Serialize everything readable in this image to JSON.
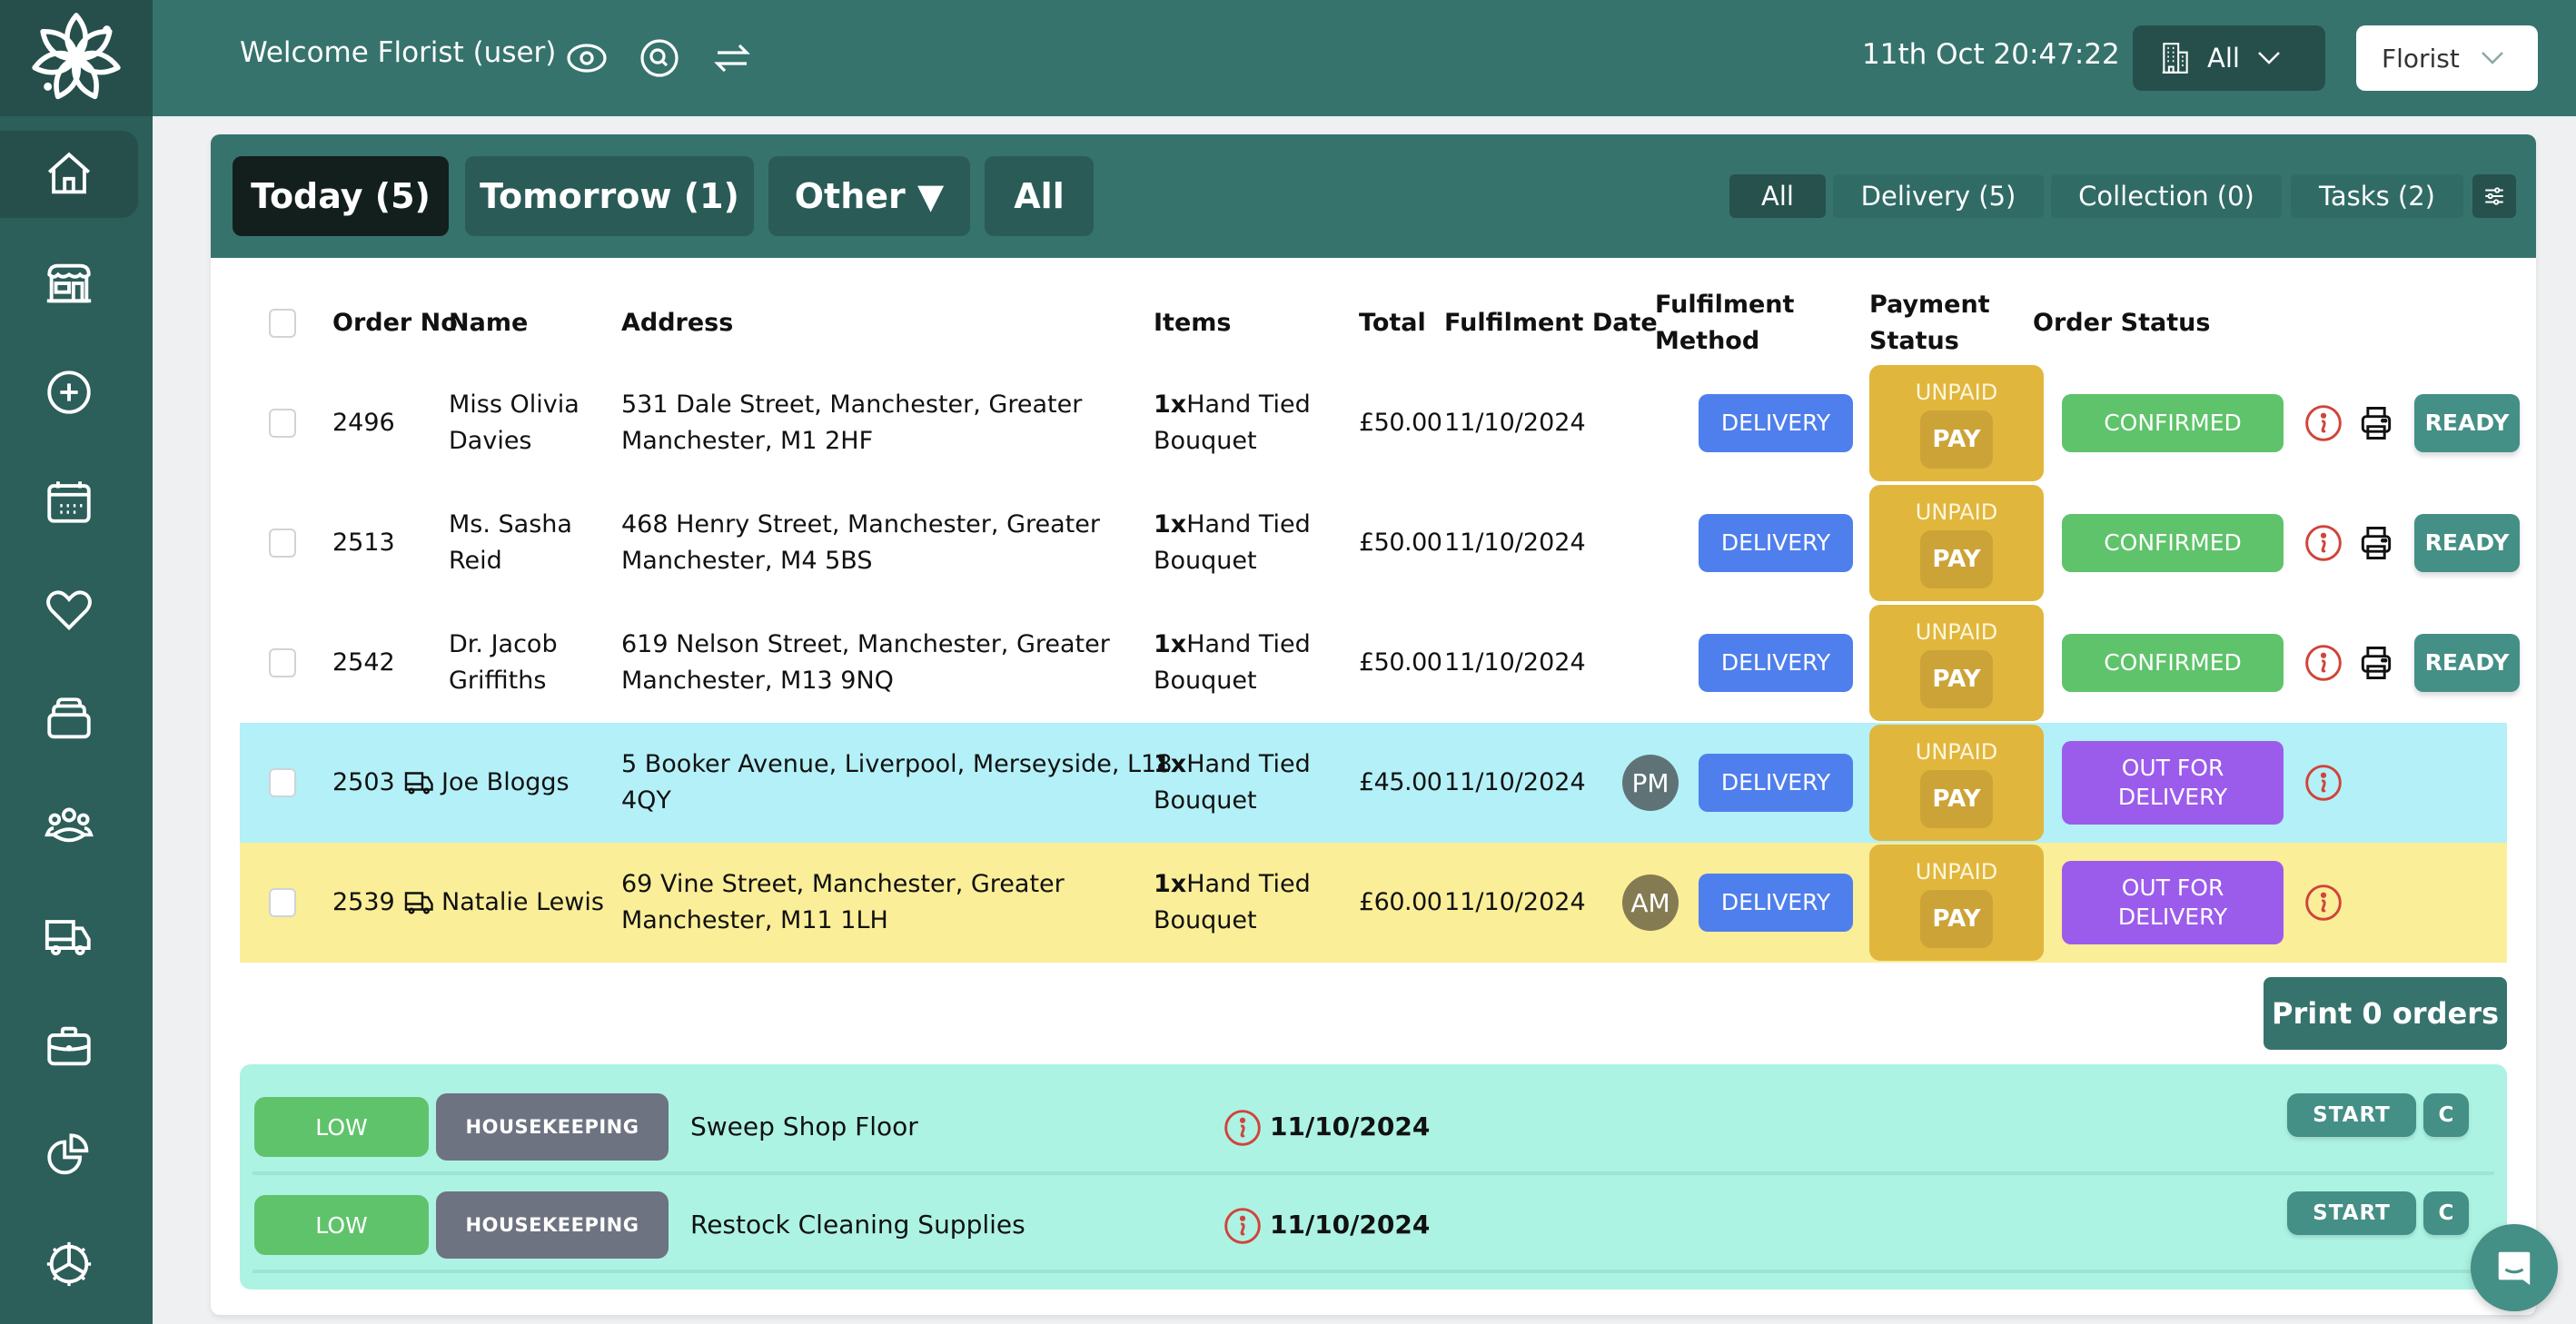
{
  "app": {
    "logo": "flower-logo"
  },
  "header": {
    "welcome": "Welcome Florist (user)",
    "icons": [
      "eye-icon",
      "search-icon",
      "swap-icon"
    ],
    "datetime": "11th Oct 20:47:22",
    "location_select": {
      "icon": "building-icon",
      "value": "All"
    },
    "role_select": {
      "value": "Florist"
    }
  },
  "sidebar": {
    "items": [
      {
        "name": "home",
        "icon": "home-icon",
        "active": true
      },
      {
        "name": "shop",
        "icon": "store-icon"
      },
      {
        "name": "new-order",
        "icon": "plus-circle-icon"
      },
      {
        "name": "calendar",
        "icon": "calendar-icon"
      },
      {
        "name": "favourites",
        "icon": "heart-icon"
      },
      {
        "name": "inventory",
        "icon": "stack-icon"
      },
      {
        "name": "customers",
        "icon": "users-icon"
      },
      {
        "name": "deliveries",
        "icon": "truck-icon"
      },
      {
        "name": "jobs",
        "icon": "briefcase-icon"
      },
      {
        "name": "reports",
        "icon": "pie-chart-icon"
      },
      {
        "name": "settings",
        "icon": "gear-icon"
      }
    ]
  },
  "day_tabs": [
    {
      "label": "Today (5)",
      "active": true
    },
    {
      "label": "Tomorrow (1)"
    },
    {
      "label": "Other ▼"
    },
    {
      "label": "All"
    }
  ],
  "type_tabs": [
    {
      "label": "All",
      "active": true
    },
    {
      "label": "Delivery (5)"
    },
    {
      "label": "Collection (0)"
    },
    {
      "label": "Tasks (2)"
    }
  ],
  "filter_icon": "sliders-icon",
  "table": {
    "headers": {
      "order_no": "Order No",
      "name": "Name",
      "address": "Address",
      "items": "Items",
      "total": "Total",
      "fulfilment_date": "Fulfilment Date",
      "fulfilment_method": [
        "Fulfilment",
        "Method"
      ],
      "payment_status": [
        "Payment",
        "Status"
      ],
      "order_status": "Order Status"
    },
    "rows": [
      {
        "order_no": "2496",
        "name": [
          "Miss Olivia",
          "Davies"
        ],
        "address": [
          "531 Dale Street, Manchester, Greater",
          "Manchester, M1 2HF"
        ],
        "qty": "1x",
        "item": [
          "Hand Tied",
          "Bouquet"
        ],
        "total": "£50.00",
        "date": "11/10/2024",
        "method": "DELIVERY",
        "payment": "UNPAID",
        "pay_label": "PAY",
        "status": [
          "CONFIRMED"
        ],
        "action": "READY",
        "highlight": "none"
      },
      {
        "order_no": "2513",
        "name": [
          "Ms. Sasha",
          "Reid"
        ],
        "address": [
          "468 Henry Street, Manchester, Greater",
          "Manchester, M4 5BS"
        ],
        "qty": "1x",
        "item": [
          "Hand Tied",
          "Bouquet"
        ],
        "total": "£50.00",
        "date": "11/10/2024",
        "method": "DELIVERY",
        "payment": "UNPAID",
        "pay_label": "PAY",
        "status": [
          "CONFIRMED"
        ],
        "action": "READY",
        "highlight": "none"
      },
      {
        "order_no": "2542",
        "name": [
          "Dr. Jacob",
          "Griffiths"
        ],
        "address": [
          "619 Nelson Street, Manchester, Greater",
          "Manchester, M13 9NQ"
        ],
        "qty": "1x",
        "item": [
          "Hand Tied",
          "Bouquet"
        ],
        "total": "£50.00",
        "date": "11/10/2024",
        "method": "DELIVERY",
        "payment": "UNPAID",
        "pay_label": "PAY",
        "status": [
          "CONFIRMED"
        ],
        "action": "READY",
        "highlight": "none"
      },
      {
        "order_no": "2503",
        "name": [
          "Joe Bloggs"
        ],
        "address": [
          "5 Booker Avenue, Liverpool, Merseyside, L18",
          "4QY"
        ],
        "qty": "1x",
        "item": [
          "Hand Tied",
          "Bouquet"
        ],
        "total": "£45.00",
        "date": "11/10/2024",
        "slot": "PM",
        "method": "DELIVERY",
        "payment": "UNPAID",
        "pay_label": "PAY",
        "status": [
          "OUT FOR",
          "DELIVERY"
        ],
        "highlight": "blue"
      },
      {
        "order_no": "2539",
        "name": [
          "Natalie Lewis"
        ],
        "address": [
          "69 Vine Street, Manchester, Greater",
          "Manchester, M11 1LH"
        ],
        "qty": "1x",
        "item": [
          "Hand Tied",
          "Bouquet"
        ],
        "total": "£60.00",
        "date": "11/10/2024",
        "slot": "AM",
        "method": "DELIVERY",
        "payment": "UNPAID",
        "pay_label": "PAY",
        "status": [
          "OUT FOR",
          "DELIVERY"
        ],
        "highlight": "yellow"
      }
    ]
  },
  "print_button": "Print 0 orders",
  "tasks": [
    {
      "priority": "LOW",
      "category": "HOUSEKEEPING",
      "title": "Sweep Shop Floor",
      "date": "11/10/2024",
      "start": "START",
      "complete": "C"
    },
    {
      "priority": "LOW",
      "category": "HOUSEKEEPING",
      "title": "Restock Cleaning Supplies",
      "date": "11/10/2024",
      "start": "START",
      "complete": "C"
    }
  ],
  "colors": {
    "brand": "#36736d",
    "sidebar": "#2c5e5a",
    "delivery": "#4f7fed",
    "unpaid": "#e0b63d",
    "confirmed": "#5fc36b",
    "out_for_delivery": "#9b5cec",
    "ready": "#448f86",
    "pm_slot": "#5f7377",
    "am_slot": "#857b52",
    "row_blue": "#b4f0f8",
    "row_yellow": "#faee98",
    "tasks_bg": "#adf3e4"
  }
}
